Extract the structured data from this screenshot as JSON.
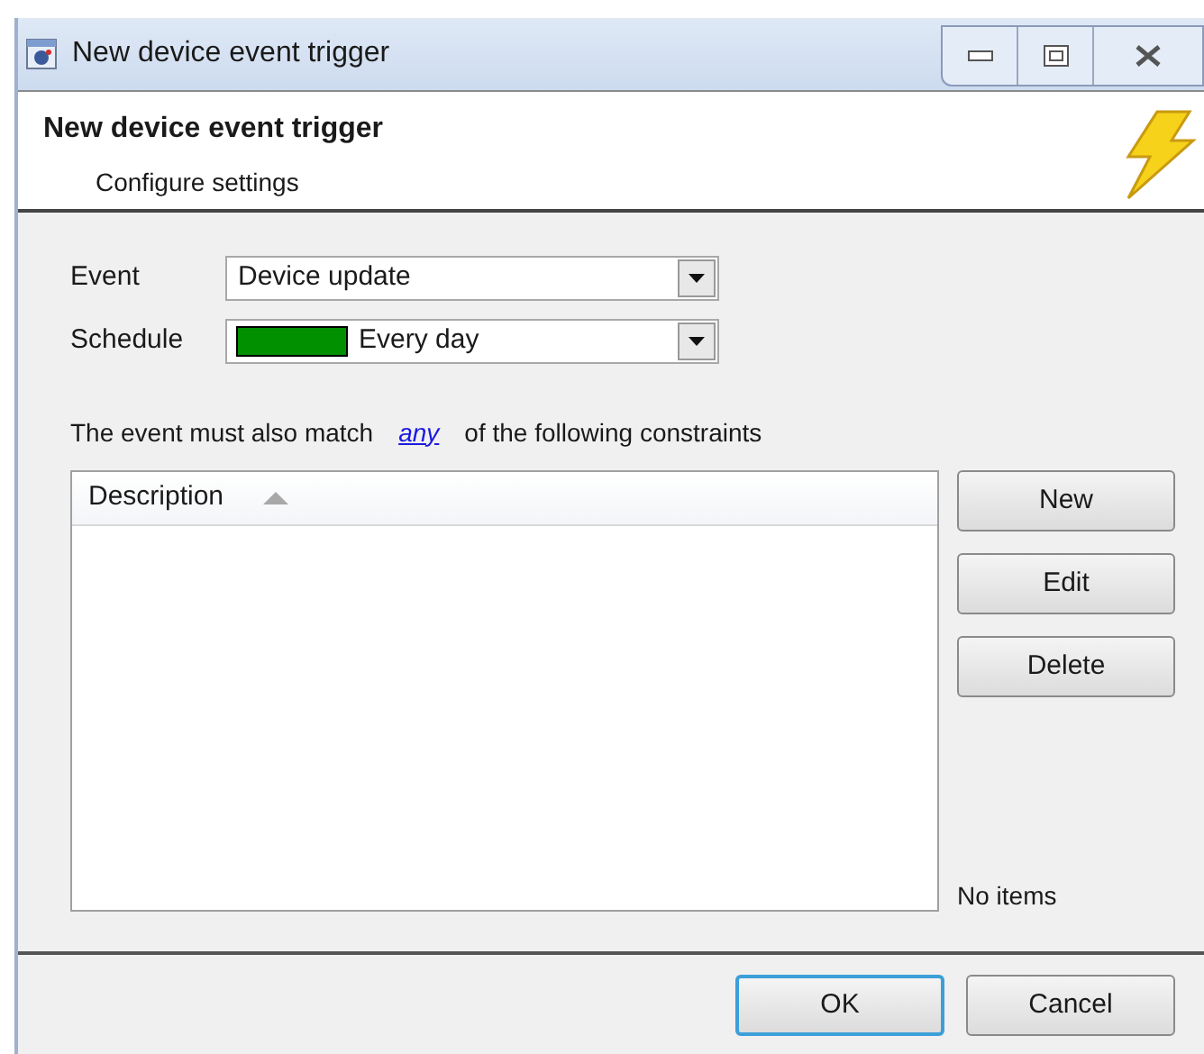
{
  "window": {
    "title": "New device event trigger"
  },
  "header": {
    "title": "New device event trigger",
    "subtitle": "Configure settings"
  },
  "fields": [
    {
      "kind": "combo",
      "label": "Event",
      "value": "Device update"
    },
    {
      "kind": "swatch-combo",
      "label": "Schedule",
      "value": "Every day",
      "color": "#009000"
    }
  ],
  "constraint_text": {
    "before": "The event must also match",
    "link": "any",
    "after": "of the following constraints"
  },
  "table": {
    "columns": [
      {
        "label": "Description",
        "sorted_ascending": true
      }
    ]
  },
  "side_buttons": [
    "New",
    "Edit",
    "Delete"
  ],
  "item_count": "No items",
  "buttons": [
    {
      "label": "OK",
      "default": true
    },
    {
      "label": "Cancel",
      "default": false
    }
  ]
}
